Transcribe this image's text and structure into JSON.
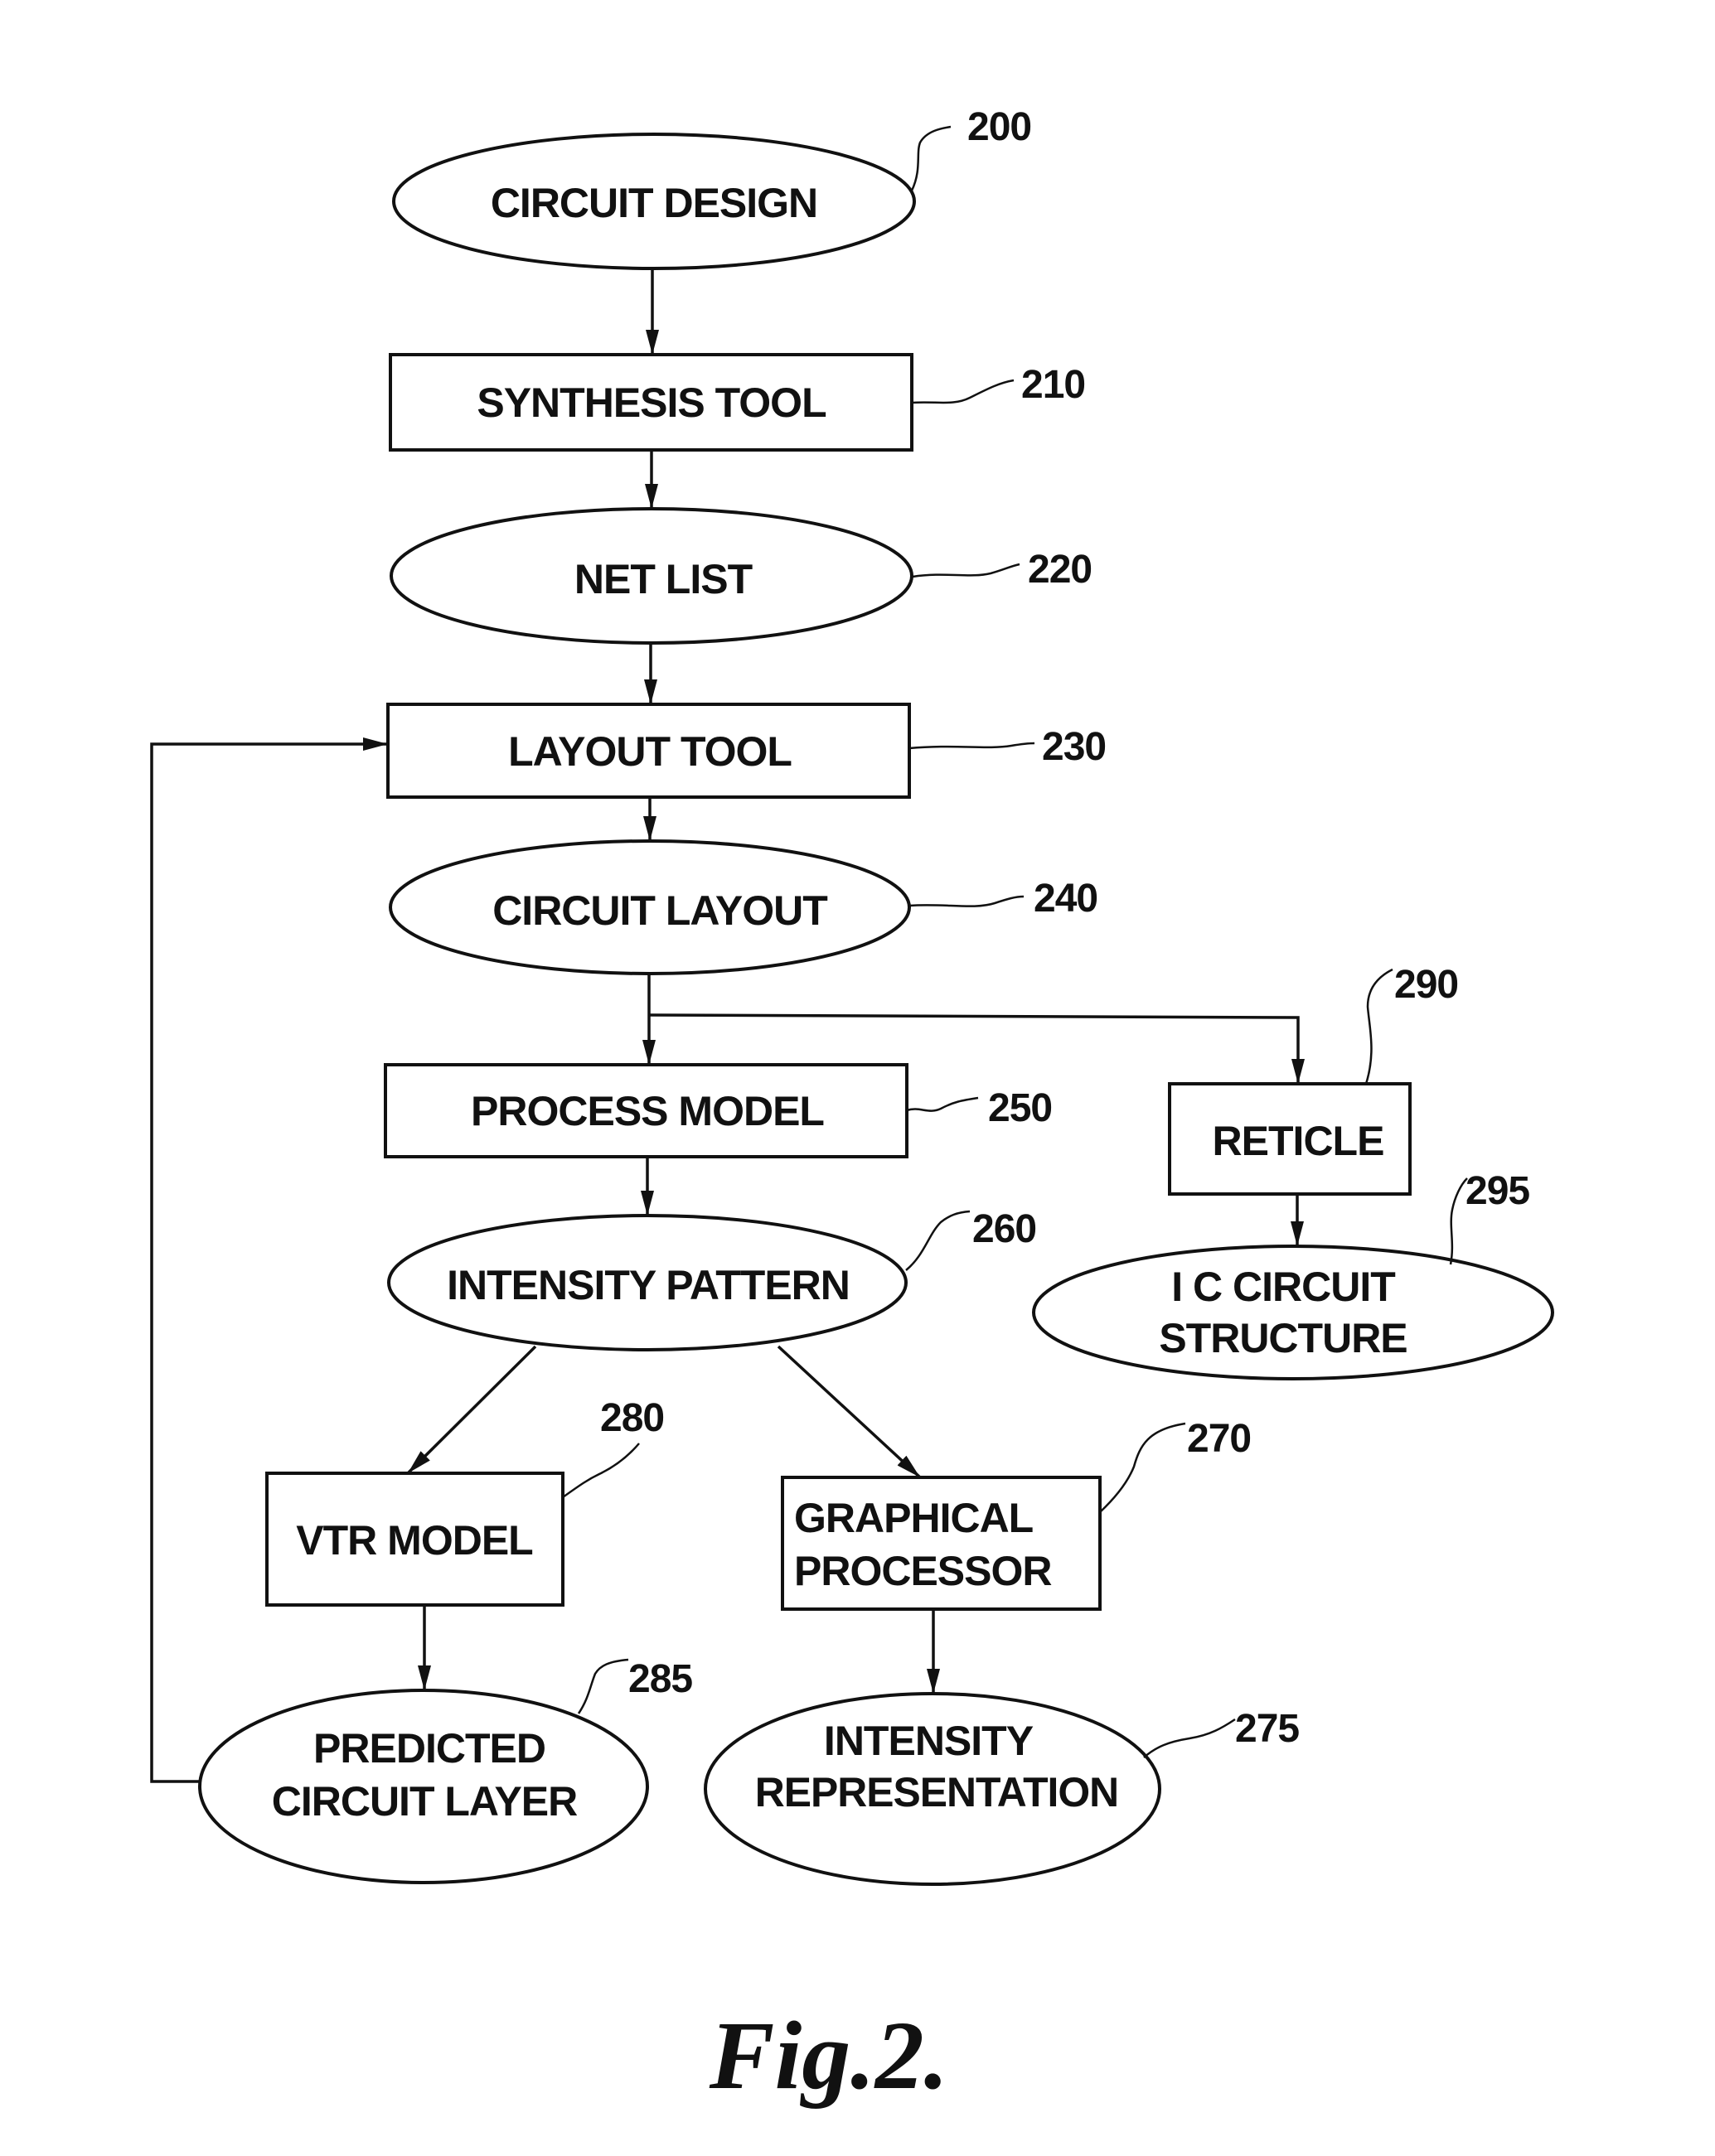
{
  "figure": {
    "caption": "Fig.2.",
    "nodes": {
      "circuit_design": {
        "ref": "200",
        "shape": "ellipse",
        "lines": [
          "CIRCUIT DESIGN"
        ]
      },
      "synthesis_tool": {
        "ref": "210",
        "shape": "box",
        "lines": [
          "SYNTHESIS TOOL"
        ]
      },
      "net_list": {
        "ref": "220",
        "shape": "ellipse",
        "lines": [
          "NET LIST"
        ]
      },
      "layout_tool": {
        "ref": "230",
        "shape": "box",
        "lines": [
          "LAYOUT TOOL"
        ]
      },
      "circuit_layout": {
        "ref": "240",
        "shape": "ellipse",
        "lines": [
          "CIRCUIT LAYOUT"
        ]
      },
      "process_model": {
        "ref": "250",
        "shape": "box",
        "lines": [
          "PROCESS MODEL"
        ]
      },
      "intensity_pattern": {
        "ref": "260",
        "shape": "ellipse",
        "lines": [
          "INTENSITY PATTERN"
        ]
      },
      "graphical_processor": {
        "ref": "270",
        "shape": "box",
        "lines": [
          "GRAPHICAL",
          "PROCESSOR"
        ]
      },
      "intensity_representation": {
        "ref": "275",
        "shape": "ellipse",
        "lines": [
          "INTENSITY",
          "REPRESENTATION"
        ]
      },
      "vtr_model": {
        "ref": "280",
        "shape": "box",
        "lines": [
          "VTR MODEL"
        ]
      },
      "predicted_circuit_layer": {
        "ref": "285",
        "shape": "ellipse",
        "lines": [
          "PREDICTED",
          "CIRCUIT LAYER"
        ]
      },
      "reticle": {
        "ref": "290",
        "shape": "box",
        "lines": [
          "RETICLE"
        ]
      },
      "ic_circuit_structure": {
        "ref": "295",
        "shape": "ellipse",
        "lines": [
          "I C CIRCUIT",
          "STRUCTURE"
        ]
      }
    },
    "edges": [
      {
        "from": "circuit_design",
        "to": "synthesis_tool"
      },
      {
        "from": "synthesis_tool",
        "to": "net_list"
      },
      {
        "from": "net_list",
        "to": "layout_tool"
      },
      {
        "from": "layout_tool",
        "to": "circuit_layout"
      },
      {
        "from": "circuit_layout",
        "to": "process_model"
      },
      {
        "from": "circuit_layout",
        "to": "reticle"
      },
      {
        "from": "process_model",
        "to": "intensity_pattern"
      },
      {
        "from": "reticle",
        "to": "ic_circuit_structure"
      },
      {
        "from": "intensity_pattern",
        "to": "vtr_model"
      },
      {
        "from": "intensity_pattern",
        "to": "graphical_processor"
      },
      {
        "from": "vtr_model",
        "to": "predicted_circuit_layer"
      },
      {
        "from": "graphical_processor",
        "to": "intensity_representation"
      },
      {
        "from": "predicted_circuit_layer",
        "to": "layout_tool",
        "type": "feedback"
      }
    ]
  }
}
